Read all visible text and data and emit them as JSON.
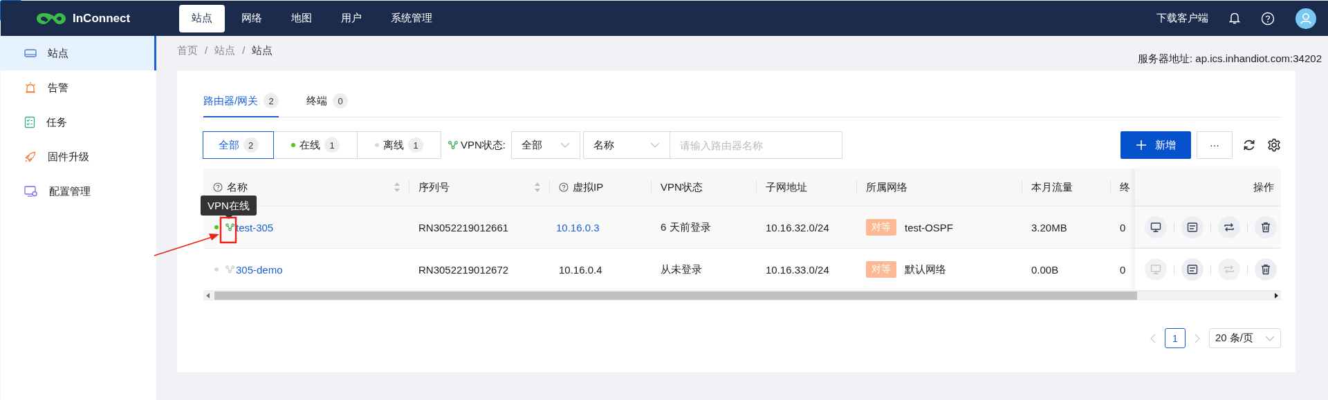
{
  "topbar": {
    "logo": "InConnect",
    "nav": [
      {
        "label": "站点",
        "selected": true
      },
      {
        "label": "网络",
        "selected": false
      },
      {
        "label": "地图",
        "selected": false
      },
      {
        "label": "用户",
        "selected": false
      },
      {
        "label": "系统管理",
        "selected": false
      }
    ],
    "download": "下载客户端"
  },
  "sidebar": {
    "items": [
      {
        "label": "站点",
        "selected": true
      },
      {
        "label": "告警",
        "selected": false
      },
      {
        "label": "任务",
        "selected": false
      },
      {
        "label": "固件升级",
        "selected": false
      },
      {
        "label": "配置管理",
        "selected": false
      }
    ]
  },
  "breadcrumb": [
    "首页",
    "站点",
    "站点"
  ],
  "breadcrumb_separator": "/",
  "server_address": "服务器地址: ap.ics.inhandiot.com:34202",
  "tabs": [
    {
      "label": "路由器/网关",
      "count": "2",
      "selected": true
    },
    {
      "label": "终端",
      "count": "0",
      "selected": false
    }
  ],
  "filters": {
    "status": [
      {
        "label": "全部",
        "count": "2",
        "selected": true
      },
      {
        "label": "在线",
        "count": "1",
        "selected": false,
        "color": "#52c41a"
      },
      {
        "label": "离线",
        "count": "1",
        "selected": false,
        "color": "#d9d9d9"
      }
    ],
    "vpn_label": "VPN状态:",
    "vpn_select": "全部",
    "field_select": "名称",
    "search": {
      "placeholder": "请输入路由器名称"
    }
  },
  "actions": {
    "add": "新增",
    "more": "···"
  },
  "table": {
    "columns": [
      {
        "label": "名称",
        "help": true,
        "sortable": true
      },
      {
        "label": "序列号",
        "help": false,
        "sortable": true
      },
      {
        "label": "虚拟IP",
        "help": true,
        "sortable": false
      },
      {
        "label": "VPN状态",
        "help": false,
        "sortable": false
      },
      {
        "label": "子网地址",
        "help": false,
        "sortable": false
      },
      {
        "label": "所属网络",
        "help": false,
        "sortable": false
      },
      {
        "label": "本月流量",
        "help": false,
        "sortable": false
      },
      {
        "label": "终"
      }
    ],
    "ops_label": "操作",
    "rows": [
      {
        "online": true,
        "vpn_online": true,
        "name": "test-305",
        "serial": "RN3052219012661",
        "virtual_ip": "10.16.0.3",
        "ip_linked": true,
        "vpn_status": "6 天前登录",
        "subnet": "10.16.32.0/24",
        "network_tag": "对等",
        "network": "test-OSPF",
        "traffic": "3.20MB",
        "terminals": "0",
        "ops": [
          {
            "disabled": false
          },
          {
            "disabled": false
          },
          {
            "disabled": false
          },
          {
            "disabled": false
          }
        ]
      },
      {
        "online": false,
        "vpn_online": false,
        "name": "305-demo",
        "serial": "RN3052219012672",
        "virtual_ip": "10.16.0.4",
        "ip_linked": false,
        "vpn_status": "从未登录",
        "subnet": "10.16.33.0/24",
        "network_tag": "对等",
        "network": "默认网络",
        "traffic": "0.00B",
        "terminals": "0",
        "ops": [
          {
            "disabled": true
          },
          {
            "disabled": false
          },
          {
            "disabled": true
          },
          {
            "disabled": false
          }
        ]
      }
    ]
  },
  "tooltip": "VPN在线",
  "pagination": {
    "prev_disabled": true,
    "next_disabled": true,
    "page": "1",
    "page_size": "20 条/页"
  }
}
